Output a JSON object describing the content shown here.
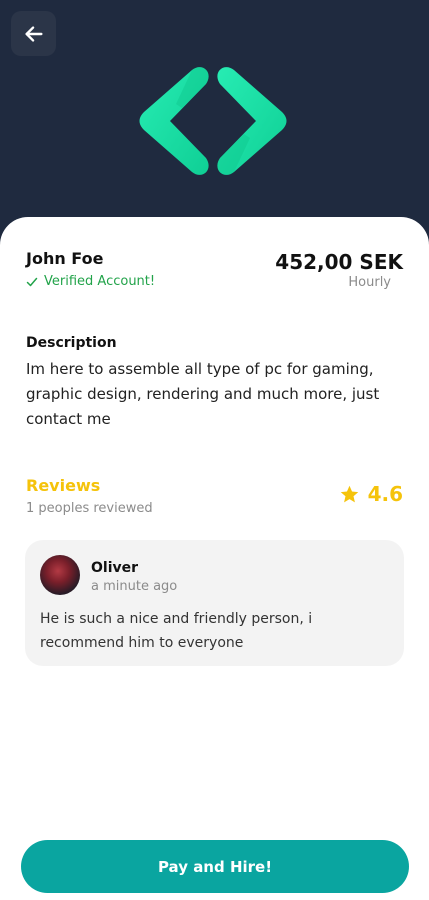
{
  "header": {
    "back_icon": "arrow-left-icon",
    "logo_icon": "code-brackets-logo",
    "logo_colors": [
      "#1fe4a8",
      "#0fcf95"
    ]
  },
  "provider": {
    "name": "John Foe",
    "verified_label": "Verified Account!",
    "verified_icon": "check-icon",
    "price": "452,00 SEK",
    "price_unit": "Hourly"
  },
  "description": {
    "title": "Description",
    "text": "Im here to assemble all type of pc for gaming, graphic design, rendering and much more, just contact me"
  },
  "reviews": {
    "title": "Reviews",
    "count_label": "1 peoples reviewed",
    "rating": "4.6",
    "star_icon": "star-icon",
    "items": [
      {
        "name": "Oliver",
        "time": "a minute ago",
        "text": "He is such a nice and friendly person, i recommend him to everyone"
      }
    ]
  },
  "actions": {
    "hire_label": "Pay and Hire!"
  },
  "colors": {
    "header_bg": "#1f2a3f",
    "accent_yellow": "#f5c30b",
    "verified_green": "#22a34a",
    "button_teal": "#0aa5a0"
  }
}
